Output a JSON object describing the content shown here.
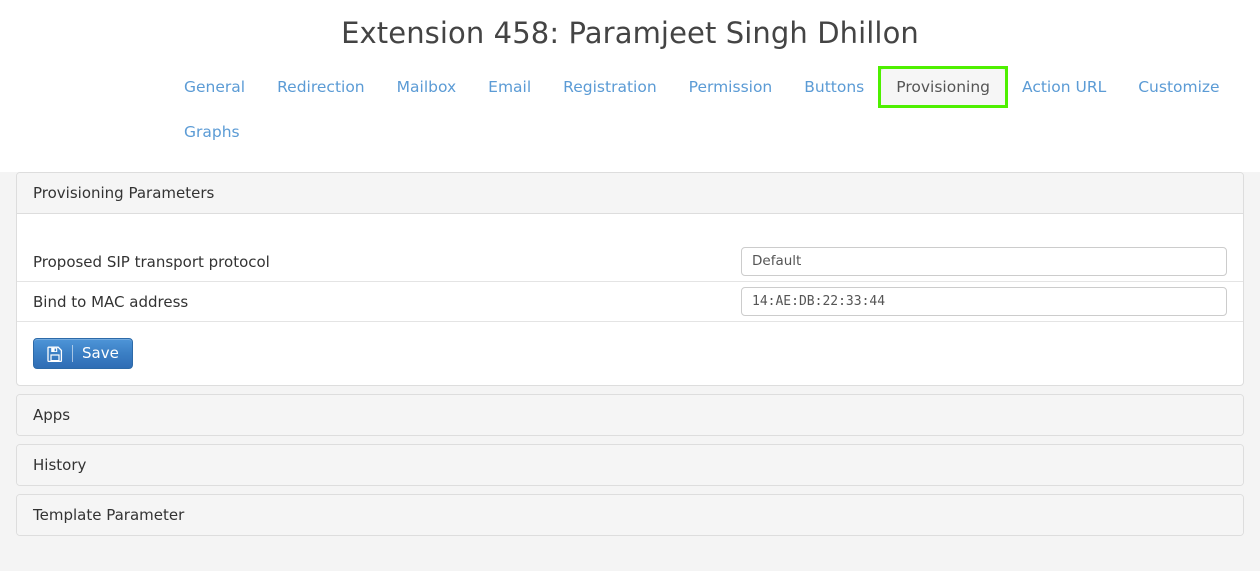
{
  "header": {
    "title": "Extension 458: Paramjeet Singh Dhillon",
    "title_color": "#444444"
  },
  "nav": {
    "active_tab": "Provisioning",
    "link_color": "#5b9bd5",
    "active_highlight_color": "#4ef000",
    "tabs_row1": [
      {
        "label": "General",
        "active": false
      },
      {
        "label": "Redirection",
        "active": false
      },
      {
        "label": "Mailbox",
        "active": false
      },
      {
        "label": "Email",
        "active": false
      },
      {
        "label": "Registration",
        "active": false
      },
      {
        "label": "Permission",
        "active": false
      },
      {
        "label": "Buttons",
        "active": false
      },
      {
        "label": "Provisioning",
        "active": true
      },
      {
        "label": "Action URL",
        "active": false
      },
      {
        "label": "Customize",
        "active": false
      }
    ],
    "tabs_row2": [
      {
        "label": "Graphs",
        "active": false
      }
    ]
  },
  "panels": {
    "provisioning": {
      "heading": "Provisioning Parameters",
      "fields": [
        {
          "label": "Proposed SIP transport protocol",
          "control": "select",
          "value": "Default",
          "options": [
            "Default"
          ]
        },
        {
          "label": "Bind to MAC address",
          "control": "text",
          "value": "14:AE:DB:22:33:44",
          "placeholder": ""
        }
      ],
      "save_button": {
        "label": "Save",
        "icon": "floppy-disk-save-icon"
      }
    },
    "collapsed": [
      {
        "heading": "Apps"
      },
      {
        "heading": "History"
      },
      {
        "heading": "Template Parameter"
      }
    ]
  }
}
